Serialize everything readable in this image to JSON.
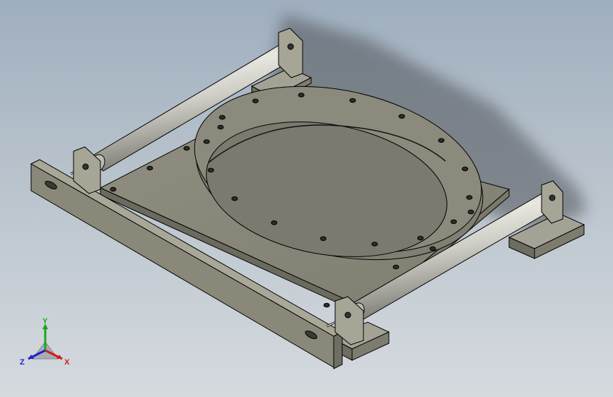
{
  "viewport": {
    "background_top": "#9fafbf",
    "background_bottom": "#d5dadf"
  },
  "model": {
    "body_color": "#8b8a7a",
    "shadow_color": "#5e5f63",
    "cylinder_color": "#c7c6bd"
  },
  "triad": {
    "x_label": "X",
    "y_label": "Y",
    "z_label": "Z",
    "x_color": "#d21c1c",
    "y_color": "#1ea51e",
    "z_color": "#2020d0"
  }
}
